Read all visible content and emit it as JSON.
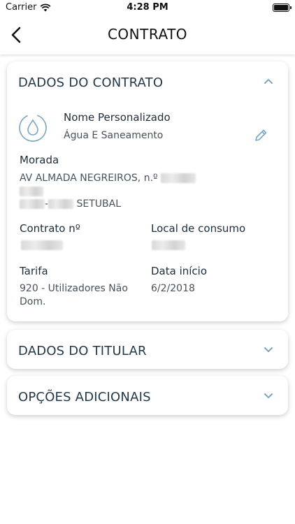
{
  "status_bar": {
    "carrier": "Carrier",
    "time": "4:28 PM"
  },
  "nav": {
    "title": "CONTRATO"
  },
  "contract_section": {
    "title": "DADOS DO CONTRATO",
    "name_label": "Nome Personalizado",
    "name_value": "Água E Saneamento",
    "address_label": "Morada",
    "address_line1": "AV ALMADA NEGREIROS, n.º",
    "address_separator": "-",
    "address_city": "SETUBAL",
    "contract_number_label": "Contrato nº",
    "consumption_place_label": "Local de consumo",
    "tariff_label": "Tarifa",
    "tariff_value_line1": "920 - Utilizadores Não",
    "tariff_value_line2": "Dom.",
    "start_date_label": "Data início",
    "start_date_value": "6/2/2018"
  },
  "holder_section": {
    "title": "DADOS DO TITULAR"
  },
  "options_section": {
    "title": "OPÇÕES ADICIONAIS"
  },
  "colors": {
    "accent": "#7aa7bf",
    "heading": "#23394a",
    "text_secondary": "#48525c"
  }
}
